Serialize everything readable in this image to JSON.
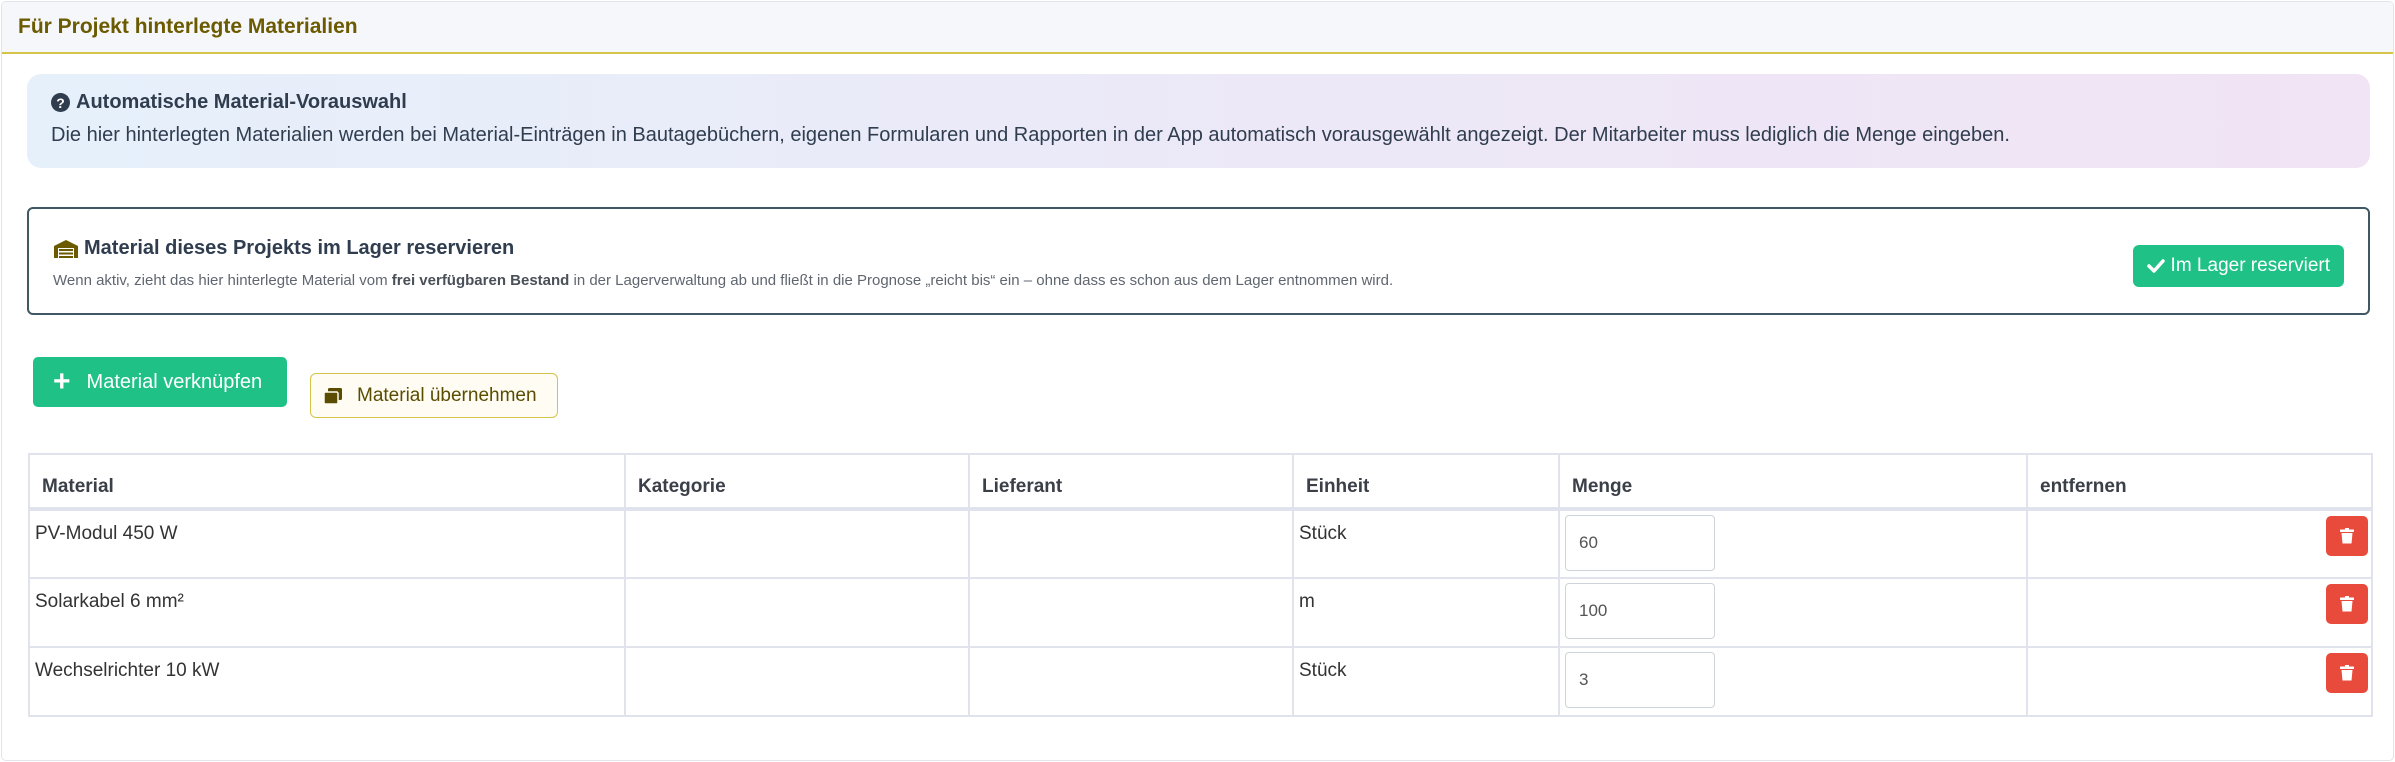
{
  "panel": {
    "title": "Für Projekt hinterlegte Materialien"
  },
  "info": {
    "title": "Automatische Material-Vorauswahl",
    "text": "Die hier hinterlegten Materialien werden bei Material-Einträgen in Bautagebüchern, eigenen Formularen und Rapporten in der App automatisch vorausgewählt angezeigt. Der Mitarbeiter muss lediglich die Menge eingeben."
  },
  "reserve": {
    "title": "Material dieses Projekts im Lager reservieren",
    "text_before": "Wenn aktiv, zieht das hier hinterlegte Material vom ",
    "text_bold": "frei verfügbaren Bestand",
    "text_after": " in der Lagerverwaltung ab und fließt in die Prognose „reicht bis“ ein – ohne dass es schon aus dem Lager entnommen wird.",
    "button_label": "Im Lager reserviert"
  },
  "actions": {
    "link_label": "Material verknüpfen",
    "copy_label": "Material übernehmen"
  },
  "table": {
    "headers": {
      "material": "Material",
      "category": "Kategorie",
      "supplier": "Lieferant",
      "unit": "Einheit",
      "quantity": "Menge",
      "remove": "entfernen"
    },
    "rows": [
      {
        "material": "PV-Modul 450 W",
        "category": "",
        "supplier": "",
        "unit": "Stück",
        "quantity": "60"
      },
      {
        "material": "Solarkabel 6 mm²",
        "category": "",
        "supplier": "",
        "unit": "m",
        "quantity": "100"
      },
      {
        "material": "Wechselrichter 10 kW",
        "category": "",
        "supplier": "",
        "unit": "Stück",
        "quantity": "3"
      }
    ]
  },
  "colors": {
    "accent_green": "#1fc187",
    "danger_red": "#e84b3c",
    "title_gold": "#6b5a00",
    "border_gold": "#d4c44a"
  },
  "icons": [
    "question-circle-icon",
    "warehouse-icon",
    "check-icon",
    "plus-icon",
    "copy-icon",
    "trash-icon"
  ]
}
